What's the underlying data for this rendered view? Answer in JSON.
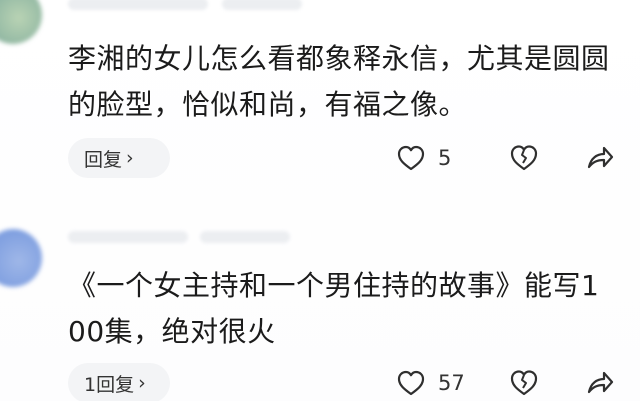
{
  "comments": [
    {
      "text": "李湘的女儿怎么看都象释永信，尤其是圆圆的脸型，恰似和尚，有福之像。",
      "reply_label": "回复",
      "like_count": "5"
    },
    {
      "text": "《一个女主持和一个男住持的故事》能写100集，绝对很火",
      "reply_label": "1回复",
      "like_count": "57"
    }
  ],
  "icons": {
    "reply_chevron": "chevron-right-icon",
    "like": "heart-icon",
    "dislike": "broken-heart-icon",
    "share": "share-arrow-icon"
  },
  "colors": {
    "text": "#1b1b1b",
    "reply_pill": "#f3f4f6",
    "icon": "#2f2f2f"
  }
}
